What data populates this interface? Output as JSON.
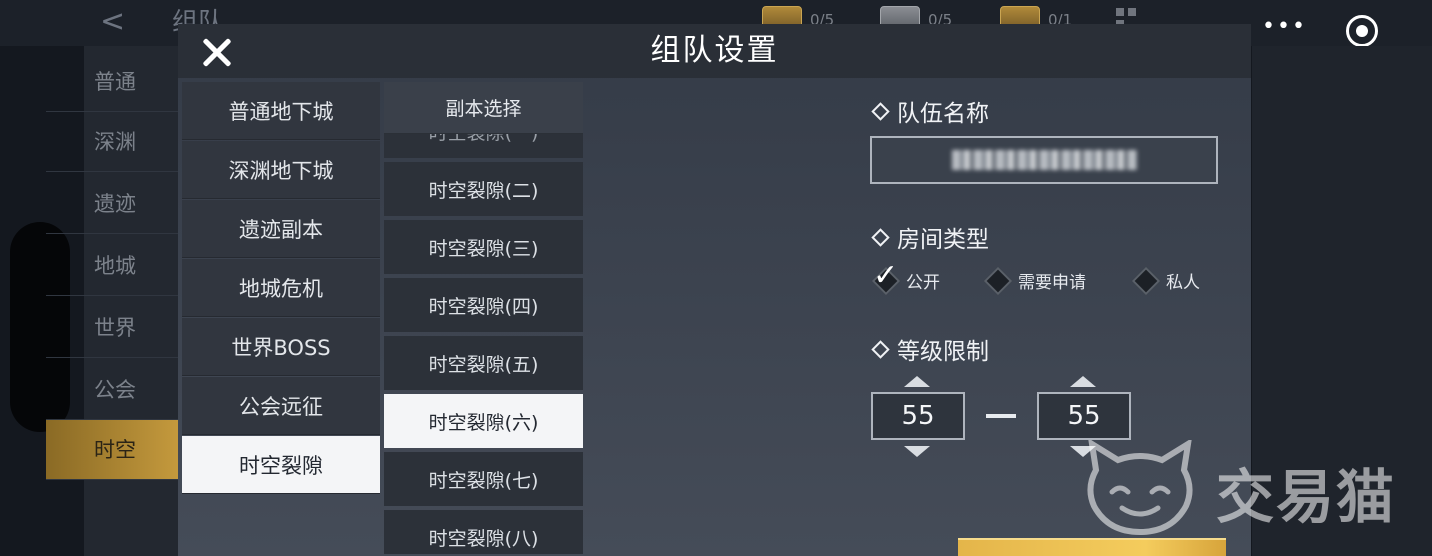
{
  "background": {
    "back_glyph": "<",
    "title": "组队",
    "currencies": [
      {
        "icon": "gold-chest-icon",
        "count": "0/5"
      },
      {
        "icon": "silver-chest-icon",
        "count": "0/5"
      },
      {
        "icon": "bronze-chest-icon",
        "count": "0/1"
      }
    ],
    "sidebar_items": [
      "普通",
      "深渊",
      "遗迹",
      "地城",
      "世界",
      "公会",
      "时空"
    ],
    "active_sidebar_index": 6,
    "more_glyph": "•••"
  },
  "modal": {
    "title": "组队设置",
    "categories": [
      "普通地下城",
      "深渊地下城",
      "遗迹副本",
      "地城危机",
      "世界BOSS",
      "公会远征",
      "时空裂隙"
    ],
    "active_category_index": 6,
    "instance_header": "副本选择",
    "instances": [
      "时空裂隙(一)",
      "时空裂隙(二)",
      "时空裂隙(三)",
      "时空裂隙(四)",
      "时空裂隙(五)",
      "时空裂隙(六)",
      "时空裂隙(七)",
      "时空裂隙(八)"
    ],
    "active_instance_index": 5,
    "team_name": {
      "label": "队伍名称"
    },
    "room_type": {
      "label": "房间类型",
      "options": [
        "公开",
        "需要申请",
        "私人"
      ],
      "selected_index": 0
    },
    "level_limit": {
      "label": "等级限制",
      "min": "55",
      "max": "55"
    }
  },
  "watermark": {
    "text": "交易猫",
    "icon": "cat-face-icon"
  },
  "colors": {
    "accent_gold": "#e9bb4d",
    "active_item": "#f4f5f7"
  }
}
